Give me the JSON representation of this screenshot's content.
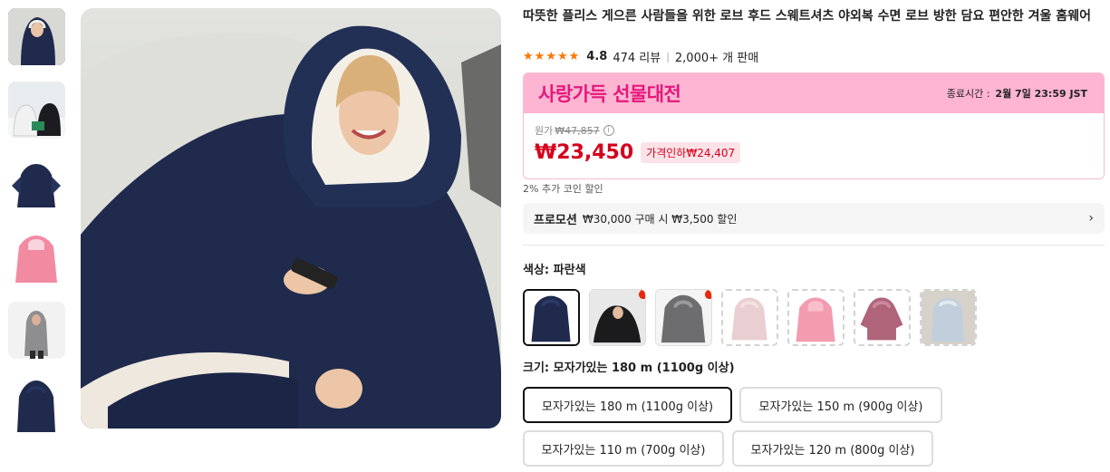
{
  "gallery": {
    "thumbnails": [
      {
        "name": "thumb-1-navy-model"
      },
      {
        "name": "thumb-2-outdoor-couple"
      },
      {
        "name": "thumb-3-navy-flat"
      },
      {
        "name": "thumb-4-pink"
      },
      {
        "name": "thumb-5-gray-model"
      },
      {
        "name": "thumb-6-navy"
      }
    ]
  },
  "product": {
    "title": "따뜻한 플리스 게으른 사람들을 위한 로브 후드 스웨트셔츠 야외복 수면 로브 방한 담요 편안한 겨울 홈웨어",
    "rating": "4.8",
    "reviews": "474 리뷰",
    "sold": "2,000+ 개 판매"
  },
  "promo": {
    "title": "사랑가득 선물대전",
    "end_label": "종료시간 :",
    "end_time": "2월 7일 23:59 JST",
    "orig_label": "원가",
    "orig_price": "₩47,857",
    "info_icon": "i",
    "price": "₩23,450",
    "discount": "가격인하₩24,407"
  },
  "coin": "2% 추가 코인 할인",
  "promotion": {
    "tag": "프로모션",
    "text": "₩30,000 구매 시 ₩3,500 할인",
    "chevron": "›"
  },
  "color": {
    "label": "색상: 파란색",
    "swatches": [
      {
        "name": "swatch-blue",
        "colors": [
          "#1f2a4d",
          "#2c3a66"
        ]
      },
      {
        "name": "swatch-black",
        "colors": [
          "#1b1b1d",
          "#3a3a3c"
        ]
      },
      {
        "name": "swatch-gray",
        "colors": [
          "#6d6d70",
          "#9a9a9c"
        ]
      },
      {
        "name": "swatch-light-pink",
        "colors": [
          "#e6c7c9",
          "#f2dcdc"
        ]
      },
      {
        "name": "swatch-pink",
        "colors": [
          "#f28aa2",
          "#f9b6c4"
        ]
      },
      {
        "name": "swatch-rose",
        "colors": [
          "#a24a63",
          "#c5728a"
        ]
      },
      {
        "name": "swatch-light-blue",
        "colors": [
          "#b7c7d6",
          "#dde6ee"
        ]
      }
    ]
  },
  "size": {
    "label": "크기: 모자가있는 180 m (1100g 이상)",
    "options": [
      "모자가있는 180 m (1100g 이상)",
      "모자가있는 150 m (900g 이상)",
      "모자가있는 110 m (700g 이상)",
      "모자가있는 120 m (800g 이상)"
    ]
  },
  "colors": {
    "accent_star": "#fb7701",
    "price_red": "#d6001c",
    "promo_pink": "#fdb5d2",
    "promo_title": "#e5177b"
  }
}
